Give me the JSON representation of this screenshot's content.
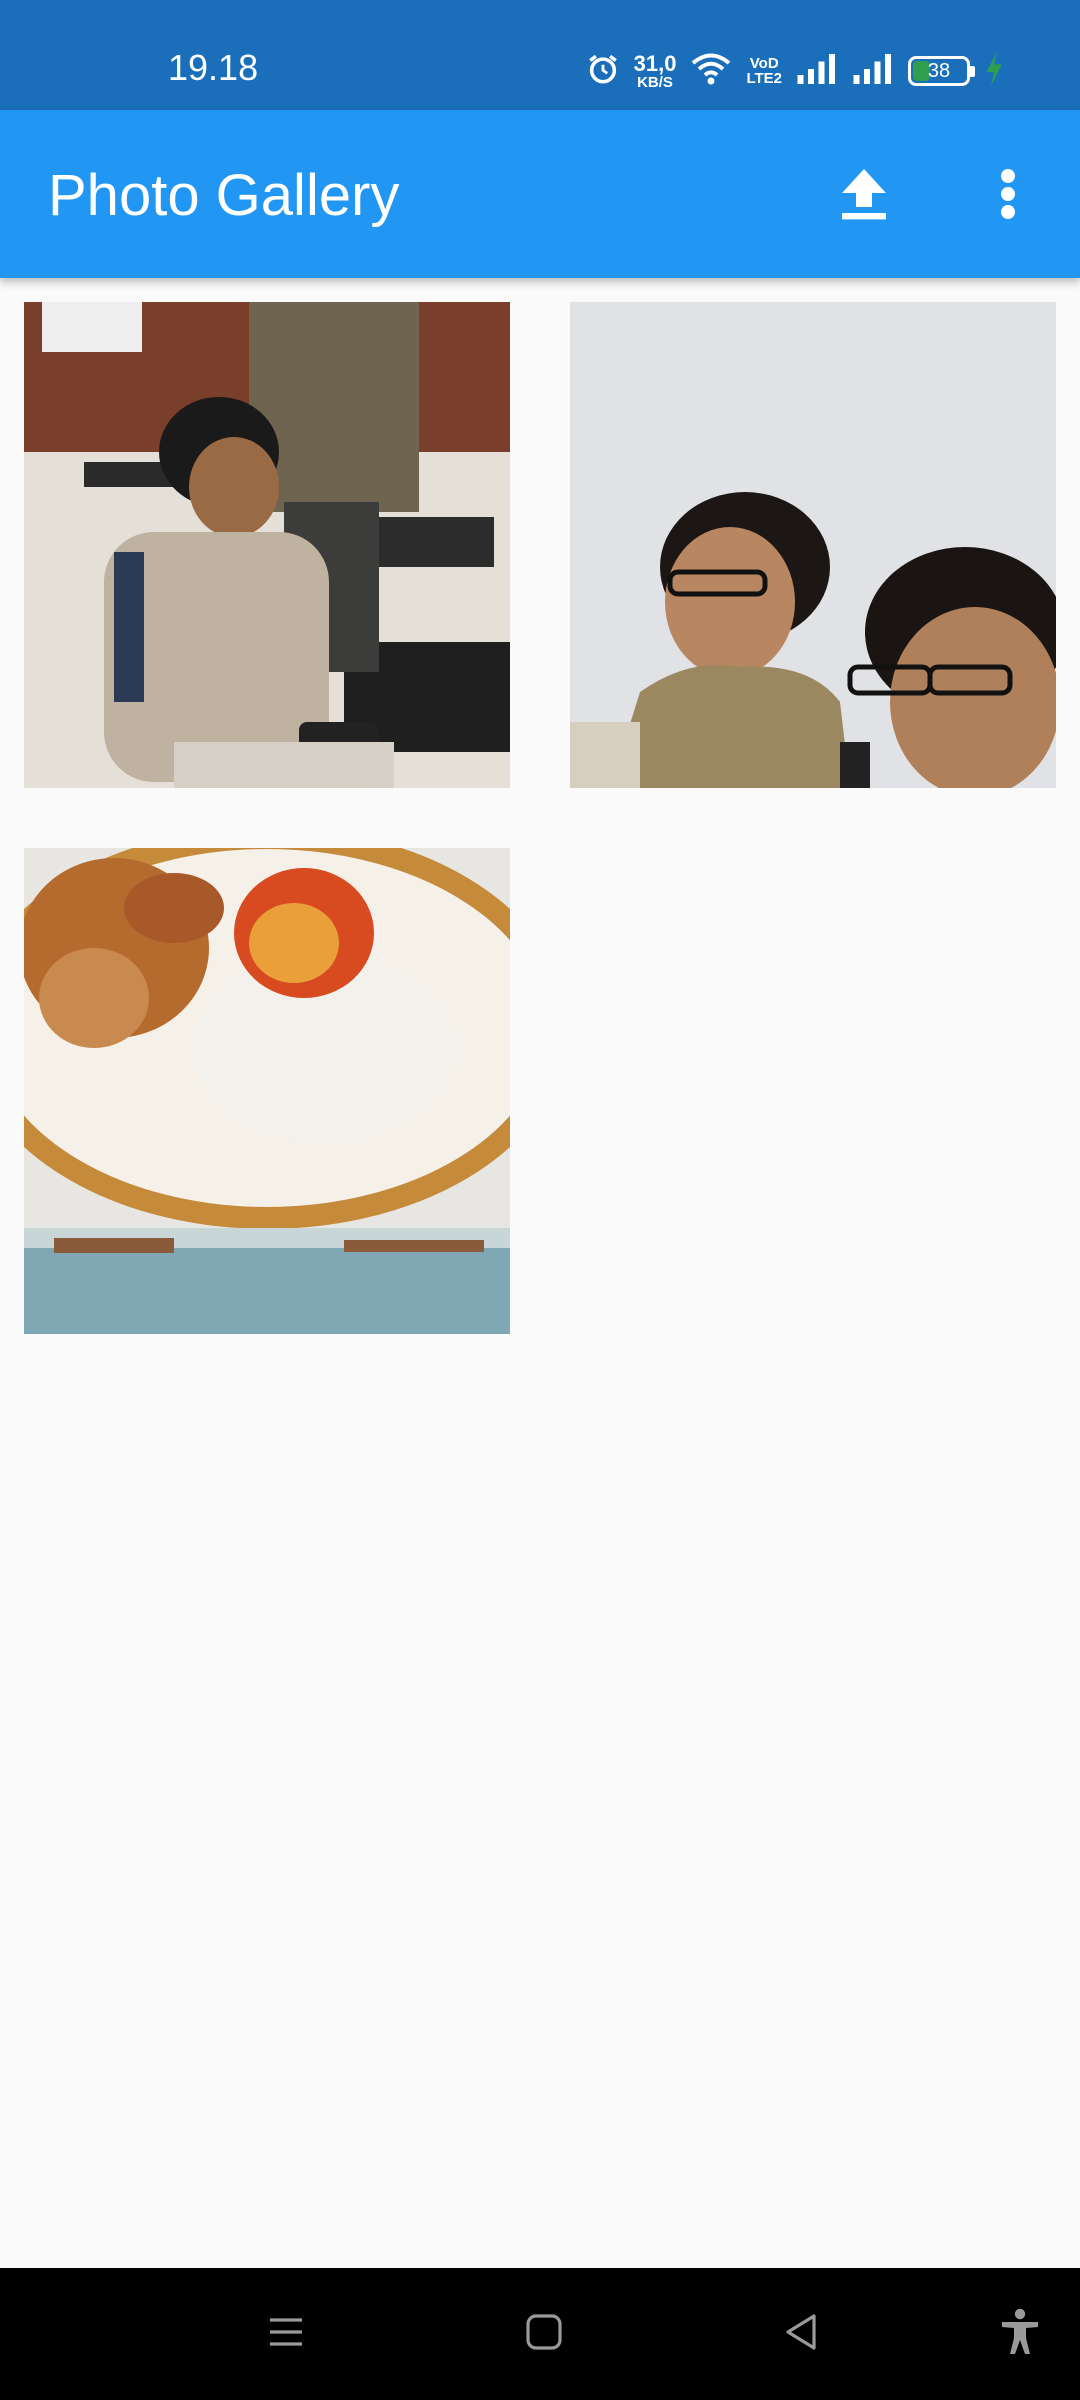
{
  "status_bar": {
    "time": "19.18",
    "net_speed_value": "31,0",
    "net_speed_unit": "KB/S",
    "volte_top": "VoD",
    "volte_bottom": "LTE2",
    "battery_level": "38",
    "battery_color": "#2e9e4f",
    "icons": [
      "alarm-icon",
      "wifi-icon",
      "signal-sim1-icon",
      "signal-sim2-icon",
      "battery-icon",
      "charging-bolt-icon"
    ]
  },
  "app_bar": {
    "title": "Photo Gallery",
    "color": "#2196f3",
    "actions": [
      "upload-icon",
      "more-vert-icon"
    ]
  },
  "gallery": {
    "photos": [
      {
        "subject": "person-seated-with-phone"
      },
      {
        "subject": "two-people-portrait"
      },
      {
        "subject": "plate-of-food"
      }
    ]
  },
  "nav_bar": {
    "buttons": [
      "recents-icon",
      "home-icon",
      "back-icon",
      "accessibility-icon"
    ]
  }
}
